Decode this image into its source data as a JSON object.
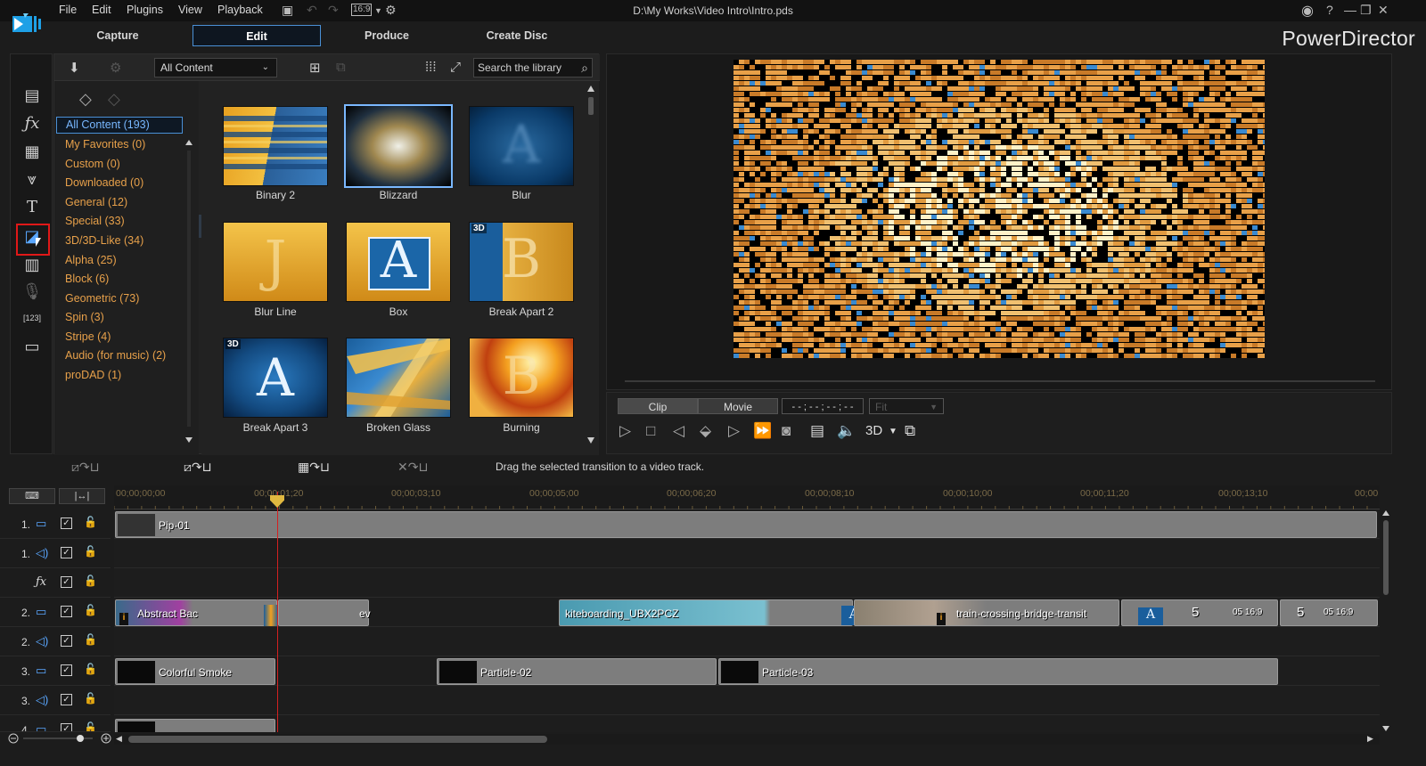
{
  "menu": {
    "items": [
      "File",
      "Edit",
      "Plugins",
      "View",
      "Playback"
    ],
    "aspect_ratio": "16:9"
  },
  "window": {
    "doc_title": "D:\\My Works\\Video Intro\\Intro.pds",
    "brand": "PowerDirector"
  },
  "modes": {
    "tabs": [
      "Capture",
      "Edit",
      "Produce",
      "Create Disc"
    ],
    "active": "Edit"
  },
  "library": {
    "content_filter": "All Content",
    "search_placeholder": "Search the library",
    "categories": [
      "All Content (193)",
      "My Favorites  (0)",
      "Custom  (0)",
      "Downloaded  (0)",
      "General  (12)",
      "Special  (33)",
      "3D/3D-Like  (34)",
      "Alpha  (25)",
      "Block  (6)",
      "Geometric  (73)",
      "Spin  (3)",
      "Stripe  (4)",
      "Audio (for music)  (2)",
      "proDAD  (1)"
    ],
    "thumbnails": [
      {
        "label": "Binary 2",
        "badge": ""
      },
      {
        "label": "Blizzard",
        "badge": ""
      },
      {
        "label": "Blur",
        "badge": ""
      },
      {
        "label": "Blur Line",
        "badge": ""
      },
      {
        "label": "Box",
        "badge": ""
      },
      {
        "label": "Break Apart 2",
        "badge": "3D"
      },
      {
        "label": "Break Apart 3",
        "badge": "3D"
      },
      {
        "label": "Broken Glass",
        "badge": ""
      },
      {
        "label": "Burning",
        "badge": ""
      }
    ]
  },
  "preview": {
    "clip_label": "Clip",
    "movie_label": "Movie",
    "timecode": "- - ; - - ; - - ; - -",
    "fit_label": "Fit",
    "mode_3d": "3D"
  },
  "timeline": {
    "hint": "Drag the selected transition to a video track.",
    "ruler_labels": [
      "00;00;00;00",
      "00;00;01;20",
      "00;00;03;10",
      "00;00;05;00",
      "00;00;06;20",
      "00;00;08;10",
      "00;00;10;00",
      "00;00;11;20",
      "00;00;13;10",
      "00;00"
    ],
    "tracks": [
      {
        "num": "1.",
        "type": "video"
      },
      {
        "num": "1.",
        "type": "audio"
      },
      {
        "num": "",
        "type": "fx"
      },
      {
        "num": "2.",
        "type": "video"
      },
      {
        "num": "2.",
        "type": "audio"
      },
      {
        "num": "3.",
        "type": "video"
      },
      {
        "num": "3.",
        "type": "audio"
      },
      {
        "num": "4.",
        "type": "video"
      }
    ],
    "clips": {
      "pip": "Pip-01",
      "abstract": "Abstract Bac",
      "ev": "ev",
      "kite": "kiteboarding_UBX2PCZ",
      "train": "train-crossing-bridge-transit",
      "count_a": "5",
      "ts_a": "05 16:9",
      "count_b": "5",
      "ts_b": "05 16:9",
      "smoke": "Colorful Smoke",
      "p2": "Particle-02",
      "p3": "Particle-03"
    }
  },
  "colors": {
    "accent_blue": "#4a90d6",
    "category_orange": "#e7a04a",
    "playhead_red": "#d42020",
    "selection_red": "#e01818"
  }
}
